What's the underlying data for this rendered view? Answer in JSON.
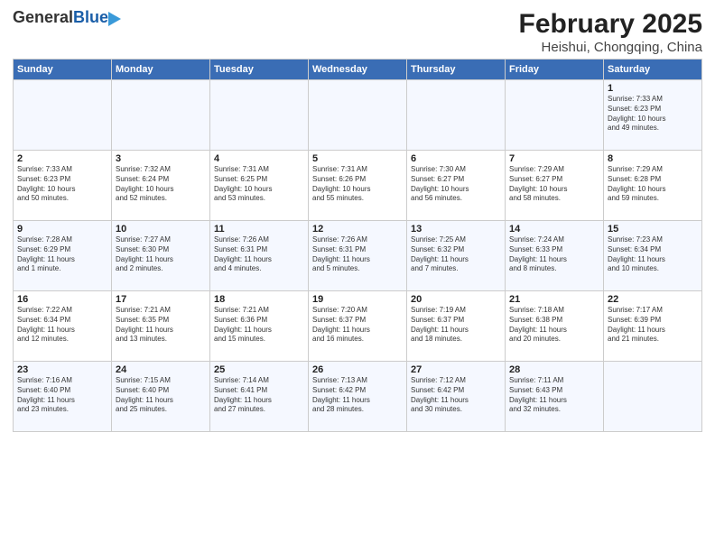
{
  "header": {
    "logo_general": "General",
    "logo_blue": "Blue",
    "title": "February 2025",
    "subtitle": "Heishui, Chongqing, China"
  },
  "weekdays": [
    "Sunday",
    "Monday",
    "Tuesday",
    "Wednesday",
    "Thursday",
    "Friday",
    "Saturday"
  ],
  "weeks": [
    [
      {
        "day": "",
        "info": ""
      },
      {
        "day": "",
        "info": ""
      },
      {
        "day": "",
        "info": ""
      },
      {
        "day": "",
        "info": ""
      },
      {
        "day": "",
        "info": ""
      },
      {
        "day": "",
        "info": ""
      },
      {
        "day": "1",
        "info": "Sunrise: 7:33 AM\nSunset: 6:23 PM\nDaylight: 10 hours\nand 49 minutes."
      }
    ],
    [
      {
        "day": "2",
        "info": "Sunrise: 7:33 AM\nSunset: 6:23 PM\nDaylight: 10 hours\nand 50 minutes."
      },
      {
        "day": "3",
        "info": "Sunrise: 7:32 AM\nSunset: 6:24 PM\nDaylight: 10 hours\nand 52 minutes."
      },
      {
        "day": "4",
        "info": "Sunrise: 7:31 AM\nSunset: 6:25 PM\nDaylight: 10 hours\nand 53 minutes."
      },
      {
        "day": "5",
        "info": "Sunrise: 7:31 AM\nSunset: 6:26 PM\nDaylight: 10 hours\nand 55 minutes."
      },
      {
        "day": "6",
        "info": "Sunrise: 7:30 AM\nSunset: 6:27 PM\nDaylight: 10 hours\nand 56 minutes."
      },
      {
        "day": "7",
        "info": "Sunrise: 7:29 AM\nSunset: 6:27 PM\nDaylight: 10 hours\nand 58 minutes."
      },
      {
        "day": "8",
        "info": "Sunrise: 7:29 AM\nSunset: 6:28 PM\nDaylight: 10 hours\nand 59 minutes."
      }
    ],
    [
      {
        "day": "9",
        "info": "Sunrise: 7:28 AM\nSunset: 6:29 PM\nDaylight: 11 hours\nand 1 minute."
      },
      {
        "day": "10",
        "info": "Sunrise: 7:27 AM\nSunset: 6:30 PM\nDaylight: 11 hours\nand 2 minutes."
      },
      {
        "day": "11",
        "info": "Sunrise: 7:26 AM\nSunset: 6:31 PM\nDaylight: 11 hours\nand 4 minutes."
      },
      {
        "day": "12",
        "info": "Sunrise: 7:26 AM\nSunset: 6:31 PM\nDaylight: 11 hours\nand 5 minutes."
      },
      {
        "day": "13",
        "info": "Sunrise: 7:25 AM\nSunset: 6:32 PM\nDaylight: 11 hours\nand 7 minutes."
      },
      {
        "day": "14",
        "info": "Sunrise: 7:24 AM\nSunset: 6:33 PM\nDaylight: 11 hours\nand 8 minutes."
      },
      {
        "day": "15",
        "info": "Sunrise: 7:23 AM\nSunset: 6:34 PM\nDaylight: 11 hours\nand 10 minutes."
      }
    ],
    [
      {
        "day": "16",
        "info": "Sunrise: 7:22 AM\nSunset: 6:34 PM\nDaylight: 11 hours\nand 12 minutes."
      },
      {
        "day": "17",
        "info": "Sunrise: 7:21 AM\nSunset: 6:35 PM\nDaylight: 11 hours\nand 13 minutes."
      },
      {
        "day": "18",
        "info": "Sunrise: 7:21 AM\nSunset: 6:36 PM\nDaylight: 11 hours\nand 15 minutes."
      },
      {
        "day": "19",
        "info": "Sunrise: 7:20 AM\nSunset: 6:37 PM\nDaylight: 11 hours\nand 16 minutes."
      },
      {
        "day": "20",
        "info": "Sunrise: 7:19 AM\nSunset: 6:37 PM\nDaylight: 11 hours\nand 18 minutes."
      },
      {
        "day": "21",
        "info": "Sunrise: 7:18 AM\nSunset: 6:38 PM\nDaylight: 11 hours\nand 20 minutes."
      },
      {
        "day": "22",
        "info": "Sunrise: 7:17 AM\nSunset: 6:39 PM\nDaylight: 11 hours\nand 21 minutes."
      }
    ],
    [
      {
        "day": "23",
        "info": "Sunrise: 7:16 AM\nSunset: 6:40 PM\nDaylight: 11 hours\nand 23 minutes."
      },
      {
        "day": "24",
        "info": "Sunrise: 7:15 AM\nSunset: 6:40 PM\nDaylight: 11 hours\nand 25 minutes."
      },
      {
        "day": "25",
        "info": "Sunrise: 7:14 AM\nSunset: 6:41 PM\nDaylight: 11 hours\nand 27 minutes."
      },
      {
        "day": "26",
        "info": "Sunrise: 7:13 AM\nSunset: 6:42 PM\nDaylight: 11 hours\nand 28 minutes."
      },
      {
        "day": "27",
        "info": "Sunrise: 7:12 AM\nSunset: 6:42 PM\nDaylight: 11 hours\nand 30 minutes."
      },
      {
        "day": "28",
        "info": "Sunrise: 7:11 AM\nSunset: 6:43 PM\nDaylight: 11 hours\nand 32 minutes."
      },
      {
        "day": "",
        "info": ""
      }
    ]
  ]
}
